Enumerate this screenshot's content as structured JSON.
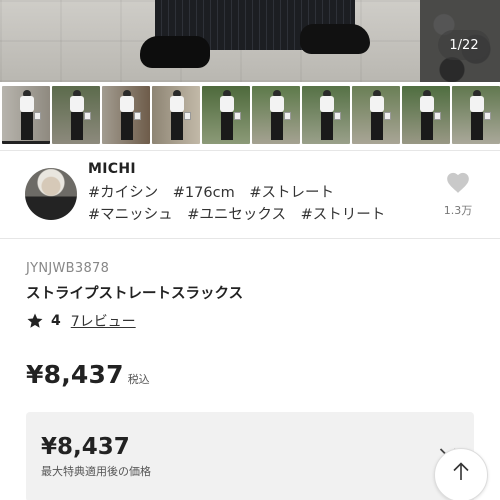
{
  "gallery": {
    "counter": "1/22",
    "thumbnail_count": 10
  },
  "user": {
    "name": "MICHI",
    "tags": [
      "#カイシン",
      "#176cm",
      "#ストレート",
      "#マニッシュ",
      "#ユニセックス",
      "#ストリート"
    ],
    "favorite_icon": "heart-icon",
    "favorite_count": "1.3万"
  },
  "product": {
    "code": "JYNJWB3878",
    "name": "ストライプストレートスラックス",
    "rating": "4",
    "review_link": "7レビュー",
    "price": "¥8,437",
    "tax_label": "税込",
    "best_price": "¥8,437",
    "best_price_label": "最大特典適用後の価格"
  },
  "colors": {
    "text": "#222222",
    "muted": "#888888",
    "box_bg": "#f1f1f1"
  }
}
